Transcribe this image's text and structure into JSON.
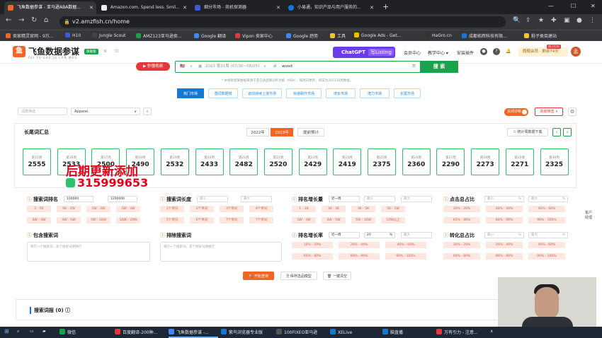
{
  "browser": {
    "tabs": [
      {
        "title": "飞鱼数据参谋 - 亚马逊ABA数据...",
        "color": "#f26522"
      },
      {
        "title": "Amazon.com. Spend less. Smil...",
        "color": "#111111"
      },
      {
        "title": "细分市场 - 商机探测器",
        "color": "#3b5bdb"
      },
      {
        "title": "小易通，知识产品与用户服务的...",
        "color": "#1677d2"
      }
    ],
    "new_tab": "+",
    "url": "v2.amzfish.cn/home",
    "bookmarks": [
      {
        "label": "卖家精灵官网 - 9万...",
        "color": "#f26522"
      },
      {
        "label": "H10",
        "color": "#3b5bdb"
      },
      {
        "label": "Jungle Scout",
        "color": "#2b2b2b"
      },
      {
        "label": "AMZ123亚马逊卖...",
        "color": "#1aa34a"
      },
      {
        "label": "Google 翻译",
        "color": "#4285f4"
      },
      {
        "label": "Vipon 卖家中心",
        "color": "#e4393c"
      },
      {
        "label": "Google 趋势",
        "color": "#4285f4"
      },
      {
        "label": "工具",
        "color": "#f4c430"
      },
      {
        "label": "Google Ads - Get...",
        "color": "#fbbc05"
      },
      {
        "label": "HaGro.cn",
        "color": "#333333"
      },
      {
        "label": "成都拓辉科技有限...",
        "color": "#1677d2"
      },
      {
        "label": "鞋子类目建站",
        "color": "#f4c430"
      }
    ]
  },
  "header": {
    "logo_mark": "鱼",
    "logo_text": "飞鱼数据参谋",
    "logo_sub": "FEI YU SHU JU CAN MOU",
    "version_badge": "旗舰版",
    "chatgpt_label": "ChatGPT",
    "chatgpt_tag": "写Listing",
    "nav": [
      "会员中心",
      "教学中心 ▾",
      "安装插件"
    ],
    "vip_label": "旗舰会员 · 剩余74天",
    "vip_tag": "续订打折",
    "avatar": "孟"
  },
  "search": {
    "video_button": "▶ 秒懂视频",
    "site": "🇺🇸",
    "period": "2023 第31周 (07/30~08/05)",
    "query": "wood",
    "button": "搜 索",
    "note": "* 本搜索结果数据来源于亚马逊品牌分析功能（ABA），每周日更新，目前为202330周数据。"
  },
  "mode_tabs": [
    {
      "label": "热门市场",
      "active": true
    },
    {
      "label": "潜词数据榜",
      "active": false
    },
    {
      "label": "波动持续上涨市场",
      "active": false
    },
    {
      "label": "快速飙升市场",
      "active": false
    },
    {
      "label": "增长市场",
      "active": false
    },
    {
      "label": "潜力市场",
      "active": false
    },
    {
      "label": "长尾市场",
      "active": false
    }
  ],
  "filters": {
    "keyword_placeholder": "词类筛选",
    "category": "Apparel",
    "toggle_label": "关闭诊断",
    "advanced_button": "高级筛选 ∧"
  },
  "summary": {
    "title": "长尾词汇总",
    "years": [
      {
        "label": "2022年",
        "active": false
      },
      {
        "label": "2023年",
        "active": true
      },
      {
        "label": "提前预计",
        "active": false
      }
    ],
    "download_button": "☉ 统计周数据下载",
    "weeks": [
      {
        "label": "第15周",
        "value": "2555"
      },
      {
        "label": "第16周",
        "value": "2533"
      },
      {
        "label": "第17周",
        "value": "2500"
      },
      {
        "label": "第18周",
        "value": "2490"
      },
      {
        "label": "第19周",
        "value": "2532"
      },
      {
        "label": "第20周",
        "value": "2433"
      },
      {
        "label": "第21周",
        "value": "2482"
      },
      {
        "label": "第22周",
        "value": "2520"
      },
      {
        "label": "第23周",
        "value": "2429"
      },
      {
        "label": "第24周",
        "value": "2419"
      },
      {
        "label": "第25周",
        "value": "2375"
      },
      {
        "label": "第26周",
        "value": "2360"
      },
      {
        "label": "第27周",
        "value": "2290"
      },
      {
        "label": "第28周",
        "value": "2273"
      },
      {
        "label": "第29周",
        "value": "2271"
      },
      {
        "label": "第30周",
        "value": "2325"
      }
    ]
  },
  "overlay": {
    "line1": "后期更新添加",
    "line2": "315999653"
  },
  "criteria": {
    "rank": {
      "title": "搜索词排名",
      "min": "100000",
      "max": "1200000",
      "chips": [
        "1 - 5K",
        "5K - 1W",
        "1W - 2W",
        "2W - 3W",
        "3W - 4W",
        "4W - 5W",
        "5W - 10W",
        "10W - 20W"
      ]
    },
    "length": {
      "title": "搜索词长度",
      "min_ph": "最小",
      "max_ph": "最大",
      "chips": [
        "1个单词",
        "2个单词",
        "3个单词",
        "4个单词",
        "5个单词",
        "6个单词",
        "7个单词",
        "7个单词"
      ]
    },
    "growth": {
      "title": "排名增长量",
      "period": "近一周",
      "min_ph": "最小",
      "max_ph": "最大",
      "chips": [
        "1 - 1K",
        "1K - 3K",
        "3K - 5K",
        "5K - 1W",
        "1W - 3W",
        "3W - 5W",
        "5W - 10W",
        "10W以上"
      ]
    },
    "click": {
      "title": "点击总占比",
      "min_ph": "最小",
      "max_ph": "最大",
      "pct": "%",
      "chips": [
        "10% - 20%",
        "20% - 40%",
        "40% - 60%",
        "60% - 80%",
        "80% - 90%",
        "90% - 100%"
      ]
    },
    "include": {
      "title": "包含搜索词",
      "placeholder": "每行一个搜索词，多个搜索词请换行"
    },
    "exclude": {
      "title": "排除搜索词",
      "placeholder": "每行一个搜索词，多个搜索词请换行"
    },
    "growth_rate": {
      "title": "排名增长率",
      "period": "近一周",
      "min": "20",
      "pct": "%",
      "max_ph": "最大",
      "chips": [
        "10% - 20%",
        "20% - 40%",
        "40% - 60%",
        "60% - 80%",
        "80% - 90%",
        "90% - 100%"
      ]
    },
    "conversion": {
      "title": "转化总占比",
      "min_ph": "最小",
      "max_ph": "最大",
      "pct": "%",
      "chips": [
        "10% - 20%",
        "20% - 40%",
        "40% - 60%",
        "60% - 80%",
        "80% - 90%",
        "90% - 100%"
      ]
    }
  },
  "actions": {
    "query": "🔍 开始查询",
    "save": "🗎 保存选品模型",
    "clear": "🗑 一键清空"
  },
  "results": {
    "title": "搜索词报 (0) ⓘ"
  },
  "side_float": "客户经理",
  "taskbar": [
    {
      "label": "微信",
      "color": "#1aa34a"
    },
    {
      "label": "百度翻译-200种...",
      "color": "#e4393c"
    },
    {
      "label": "飞鱼数据参谋 -...",
      "color": "#4285f4"
    },
    {
      "label": "紫鸟浏览器专业版",
      "color": "#1677d2"
    },
    {
      "label": "100FIXEO亚马逊",
      "color": "#333333"
    },
    {
      "label": "XELive",
      "color": "#1677d2"
    },
    {
      "label": "脑直播",
      "color": "#1677d2"
    },
    {
      "label": "万有引力 - 注意...",
      "color": "#e4393c"
    }
  ]
}
